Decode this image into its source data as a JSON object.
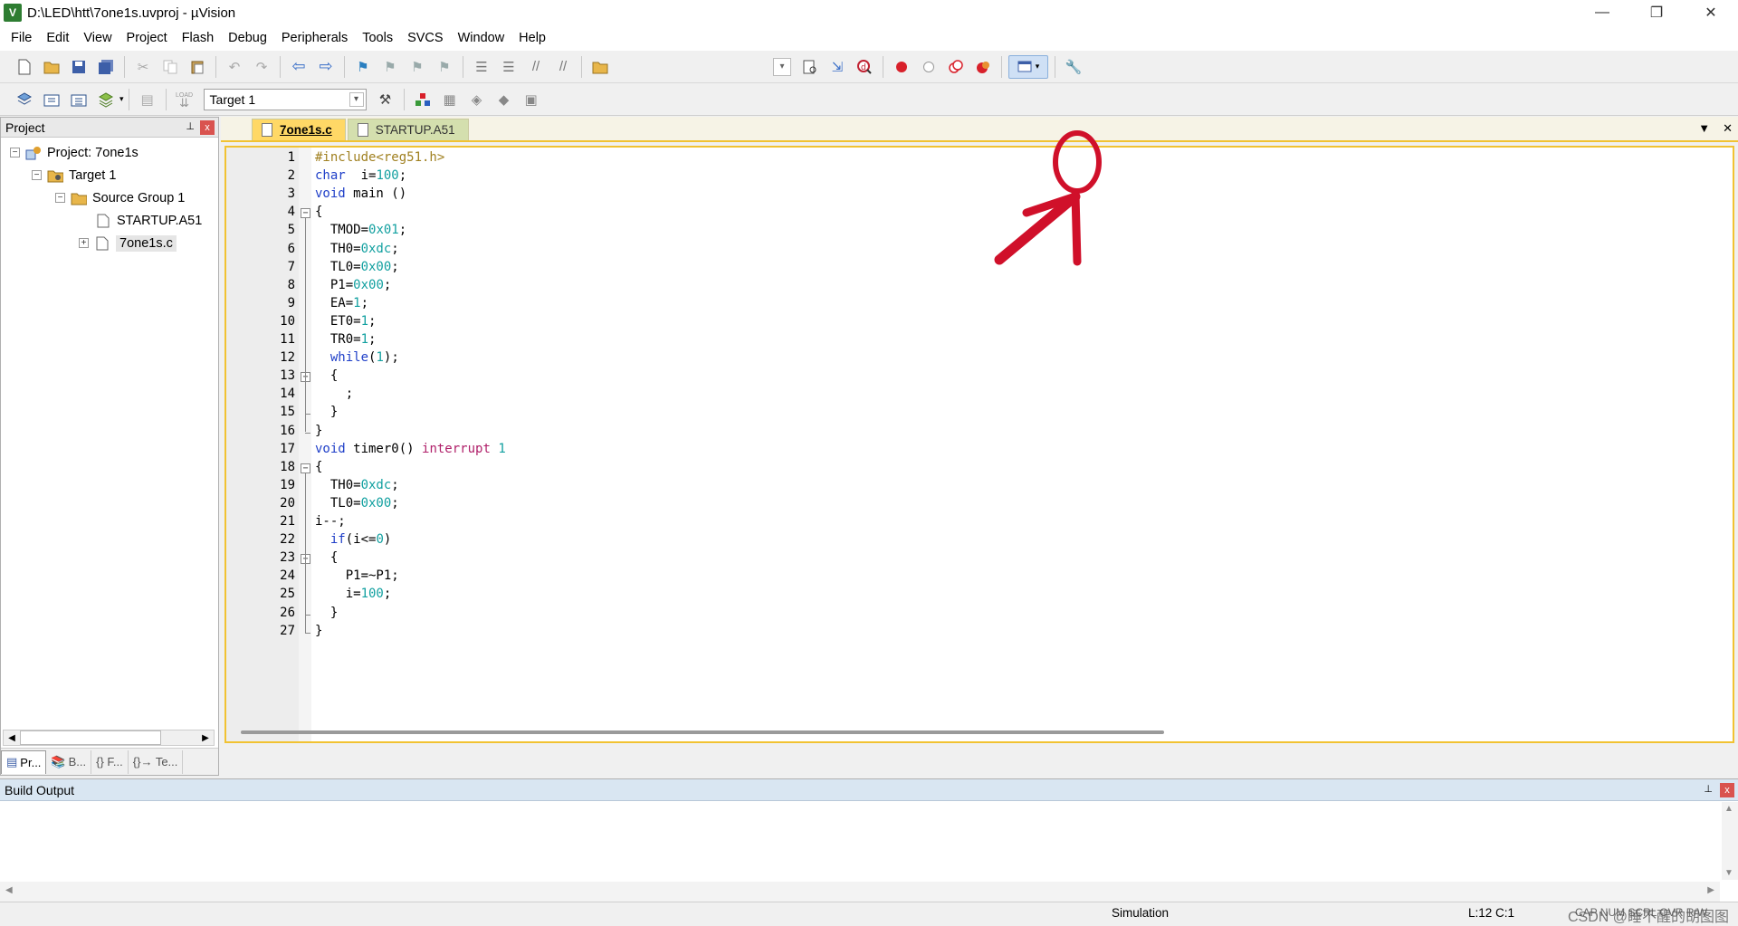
{
  "titlebar": {
    "title": "D:\\LED\\htt\\7one1s.uvproj - µVision",
    "app_icon": "V",
    "minimize": "—",
    "restore": "❐",
    "close": "✕"
  },
  "menu": [
    "File",
    "Edit",
    "View",
    "Project",
    "Flash",
    "Debug",
    "Peripherals",
    "Tools",
    "SVCS",
    "Window",
    "Help"
  ],
  "toolbar2": {
    "target": "Target 1",
    "load_label": "LOAD"
  },
  "project_panel": {
    "title": "Project",
    "pin": "📌",
    "close": "x",
    "tree": [
      {
        "label": "Project: 7one1s",
        "expander": "−"
      },
      {
        "label": "Target 1",
        "expander": "−"
      },
      {
        "label": "Source Group 1",
        "expander": "−"
      },
      {
        "label": "STARTUP.A51"
      },
      {
        "label": "7one1s.c",
        "expander": "+"
      }
    ],
    "tabs": [
      "Pr...",
      "B...",
      "{} F...",
      "{}→ Te..."
    ]
  },
  "editor": {
    "tabs": [
      {
        "label": "7one1s.c",
        "active": true
      },
      {
        "label": "STARTUP.A51",
        "active": false
      }
    ],
    "code": [
      [
        {
          "t": "pre",
          "s": "#include<reg51.h>"
        }
      ],
      [
        {
          "t": "kw",
          "s": "char"
        },
        {
          "t": "pl",
          "s": "  i="
        },
        {
          "t": "num",
          "s": "100"
        },
        {
          "t": "pl",
          "s": ";"
        }
      ],
      [
        {
          "t": "kw",
          "s": "void"
        },
        {
          "t": "pl",
          "s": " main ()"
        }
      ],
      [
        {
          "t": "pl",
          "s": "{"
        }
      ],
      [
        {
          "t": "pl",
          "s": "  TMOD="
        },
        {
          "t": "num",
          "s": "0x01"
        },
        {
          "t": "pl",
          "s": ";"
        }
      ],
      [
        {
          "t": "pl",
          "s": "  TH0="
        },
        {
          "t": "num",
          "s": "0xdc"
        },
        {
          "t": "pl",
          "s": ";"
        }
      ],
      [
        {
          "t": "pl",
          "s": "  TL0="
        },
        {
          "t": "num",
          "s": "0x00"
        },
        {
          "t": "pl",
          "s": ";"
        }
      ],
      [
        {
          "t": "pl",
          "s": "  P1="
        },
        {
          "t": "num",
          "s": "0x00"
        },
        {
          "t": "pl",
          "s": ";"
        }
      ],
      [
        {
          "t": "pl",
          "s": "  EA="
        },
        {
          "t": "num",
          "s": "1"
        },
        {
          "t": "pl",
          "s": ";"
        }
      ],
      [
        {
          "t": "pl",
          "s": "  ET0="
        },
        {
          "t": "num",
          "s": "1"
        },
        {
          "t": "pl",
          "s": ";"
        }
      ],
      [
        {
          "t": "pl",
          "s": "  TR0="
        },
        {
          "t": "num",
          "s": "1"
        },
        {
          "t": "pl",
          "s": ";"
        }
      ],
      [
        {
          "t": "pl",
          "s": "  "
        },
        {
          "t": "kw",
          "s": "while"
        },
        {
          "t": "pl",
          "s": "("
        },
        {
          "t": "num",
          "s": "1"
        },
        {
          "t": "pl",
          "s": ");"
        }
      ],
      [
        {
          "t": "pl",
          "s": "  {"
        }
      ],
      [
        {
          "t": "pl",
          "s": "    ;"
        }
      ],
      [
        {
          "t": "pl",
          "s": "  }"
        }
      ],
      [
        {
          "t": "pl",
          "s": "}"
        }
      ],
      [
        {
          "t": "kw",
          "s": "void"
        },
        {
          "t": "pl",
          "s": " timer0() "
        },
        {
          "t": "int",
          "s": "interrupt"
        },
        {
          "t": "pl",
          "s": " "
        },
        {
          "t": "num",
          "s": "1"
        }
      ],
      [
        {
          "t": "pl",
          "s": "{"
        }
      ],
      [
        {
          "t": "pl",
          "s": "  TH0="
        },
        {
          "t": "num",
          "s": "0xdc"
        },
        {
          "t": "pl",
          "s": ";"
        }
      ],
      [
        {
          "t": "pl",
          "s": "  TL0="
        },
        {
          "t": "num",
          "s": "0x00"
        },
        {
          "t": "pl",
          "s": ";"
        }
      ],
      [
        {
          "t": "pl",
          "s": "i--;"
        }
      ],
      [
        {
          "t": "pl",
          "s": "  "
        },
        {
          "t": "kw",
          "s": "if"
        },
        {
          "t": "pl",
          "s": "(i<="
        },
        {
          "t": "num",
          "s": "0"
        },
        {
          "t": "pl",
          "s": ")"
        }
      ],
      [
        {
          "t": "pl",
          "s": "  {"
        }
      ],
      [
        {
          "t": "pl",
          "s": "    P1=~P1;"
        }
      ],
      [
        {
          "t": "pl",
          "s": "    i="
        },
        {
          "t": "num",
          "s": "100"
        },
        {
          "t": "pl",
          "s": ";"
        }
      ],
      [
        {
          "t": "pl",
          "s": "  }"
        }
      ],
      [
        {
          "t": "pl",
          "s": "}"
        }
      ]
    ],
    "fold_markers": [
      {
        "line": 4,
        "sign": "−"
      },
      {
        "line": 13,
        "sign": "−"
      },
      {
        "line": 18,
        "sign": "−"
      },
      {
        "line": 23,
        "sign": "−"
      }
    ],
    "fold_ends": [
      15,
      16,
      26,
      27
    ]
  },
  "build_output": {
    "title": "Build Output",
    "pin": "📌",
    "close": "x"
  },
  "statusbar": {
    "mode": "Simulation",
    "position": "L:12 C:1",
    "indicators": "CAP  NUM  SCRL  OVR  R/W",
    "watermark": "CSDN @睡不醒的胡图图"
  },
  "colors": {
    "accent_tab": "#ffd866",
    "inactive_tab": "#d4dfae",
    "annotation": "#d0102a"
  }
}
